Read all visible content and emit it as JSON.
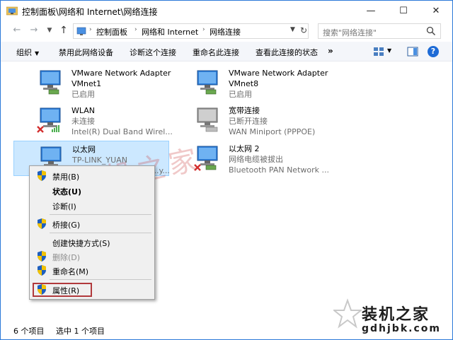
{
  "window": {
    "title": "控制面板\\网络和 Internet\\网络连接",
    "minimize": "—",
    "maximize": "☐",
    "close": "✕"
  },
  "address": {
    "crumbs": [
      "控制面板",
      "网络和 Internet",
      "网络连接"
    ],
    "search_placeholder": "搜索\"网络连接\""
  },
  "commands": {
    "organize": "组织",
    "disable": "禁用此网络设备",
    "diagnose": "诊断这个连接",
    "rename": "重命名此连接",
    "view_status": "查看此连接的状态",
    "more": "»"
  },
  "connections": [
    {
      "name": "VMware Network Adapter",
      "line2": "VMnet1",
      "line3": "已启用",
      "icon": "network-adapter-icon",
      "status": "enabled"
    },
    {
      "name": "VMware Network Adapter",
      "line2": "VMnet8",
      "line3": "已启用",
      "icon": "network-adapter-icon",
      "status": "enabled"
    },
    {
      "name": "WLAN",
      "line2": "未连接",
      "line3": "Intel(R) Dual Band Wirel...",
      "icon": "wlan-icon",
      "status": "disconnected"
    },
    {
      "name": "宽带连接",
      "line2": "已断开连接",
      "line3": "WAN Miniport (PPPOE)",
      "icon": "broadband-icon",
      "status": "disconnected"
    },
    {
      "name": "以太网",
      "line2": "TP-LINK_YUAN",
      "line3": "...y...",
      "icon": "ethernet-icon",
      "status": "selected"
    },
    {
      "name": "以太网 2",
      "line2": "网络电缆被拔出",
      "line3": "Bluetooth PAN Network ...",
      "icon": "ethernet-icon",
      "status": "unplugged"
    }
  ],
  "context_menu": {
    "items": [
      {
        "label": "禁用(B)",
        "shield": true,
        "bold": false,
        "disabled": false
      },
      {
        "label": "状态(U)",
        "shield": false,
        "bold": true,
        "disabled": false
      },
      {
        "label": "诊断(I)",
        "shield": false,
        "bold": false,
        "disabled": false
      },
      {
        "label": "桥接(G)",
        "shield": true,
        "bold": false,
        "disabled": false
      },
      {
        "label": "创建快捷方式(S)",
        "shield": false,
        "bold": false,
        "disabled": false
      },
      {
        "label": "删除(D)",
        "shield": true,
        "bold": false,
        "disabled": true
      },
      {
        "label": "重命名(M)",
        "shield": true,
        "bold": false,
        "disabled": false
      },
      {
        "label": "属性(R)",
        "shield": true,
        "bold": false,
        "disabled": false
      }
    ]
  },
  "status": {
    "item_count": "6 个项目",
    "selected_count": "选中 1 个项目"
  },
  "watermark": {
    "text": "装机之家",
    "logo_main": "装机之家",
    "logo_sub": "gdhjbk.com"
  },
  "colors": {
    "accent": "#2b79d8",
    "selected_bg": "#cce8ff",
    "highlight_border": "#b1393c"
  }
}
